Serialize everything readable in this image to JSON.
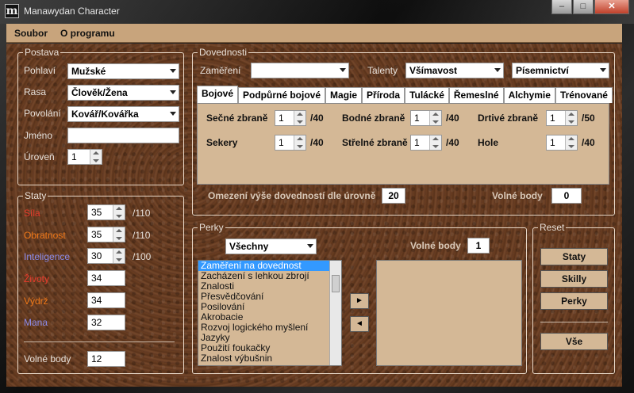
{
  "window": {
    "title": "Manawydan Character",
    "icon_letter": "m"
  },
  "menu": {
    "items": [
      "Soubor",
      "O programu"
    ]
  },
  "postava": {
    "title": "Postava",
    "pohlavi_label": "Pohlaví",
    "pohlavi_value": "Mužské",
    "rasa_label": "Rasa",
    "rasa_value": "Člověk/Žena",
    "povolani_label": "Povolání",
    "povolani_value": "Kovář/Kovářka",
    "jmeno_label": "Jméno",
    "jmeno_value": "",
    "uroven_label": "Úroveň",
    "uroven_value": "1"
  },
  "staty": {
    "title": "Staty",
    "items": [
      {
        "label": "Síla",
        "value": "35",
        "max": "/110",
        "color": "#e83c2c"
      },
      {
        "label": "Obratnost",
        "value": "35",
        "max": "/110",
        "color": "#f07818"
      },
      {
        "label": "Inteligence",
        "value": "30",
        "max": "/100",
        "color": "#8a8ae8"
      },
      {
        "label": "Životy",
        "value": "34",
        "color": "#e83c2c"
      },
      {
        "label": "Výdrž",
        "value": "34",
        "color": "#f07818"
      },
      {
        "label": "Mana",
        "value": "32",
        "color": "#8a8ae8"
      }
    ],
    "volne_label": "Volné body",
    "volne_value": "12"
  },
  "dovednosti": {
    "title": "Dovednosti",
    "zamereni_label": "Zaměření",
    "zamereni_value": "",
    "talenty_label": "Talenty",
    "talent1": "Všímavost",
    "talent2": "Písemnictví",
    "tabs": [
      "Bojové",
      "Podpůrné bojové",
      "Magie",
      "Příroda",
      "Tulácké",
      "Řemeslné",
      "Alchymie",
      "Trénované"
    ],
    "skills": [
      {
        "label": "Sečné zbraně",
        "value": "1",
        "max": "/40"
      },
      {
        "label": "Bodné zbraně",
        "value": "1",
        "max": "/40"
      },
      {
        "label": "Drtivé zbraně",
        "value": "1",
        "max": "/50"
      },
      {
        "label": "Sekery",
        "value": "1",
        "max": "/40"
      },
      {
        "label": "Střelné zbraně",
        "value": "1",
        "max": "/40"
      },
      {
        "label": "Hole",
        "value": "1",
        "max": "/40"
      }
    ],
    "omezeni_label": "Omezení výše dovedností dle úrovně",
    "omezeni_value": "20",
    "volne_label": "Volné body",
    "volne_value": "0"
  },
  "perky": {
    "title": "Perky",
    "filter_value": "Všechny",
    "volne_label": "Volné body",
    "volne_value": "1",
    "list": [
      "Zaměření na dovednost",
      "Zacházení s lehkou zbrojí",
      "Znalosti",
      "Přesvědčování",
      "Posilování",
      "Akrobacie",
      "Rozvoj logického myšlení",
      "Jazyky",
      "Použití foukačky",
      "Znalost výbušnin"
    ],
    "add_glyph": "►",
    "remove_glyph": "◄"
  },
  "reset": {
    "title": "Reset",
    "buttons": [
      "Staty",
      "Skilly",
      "Perky",
      "Vše"
    ]
  }
}
